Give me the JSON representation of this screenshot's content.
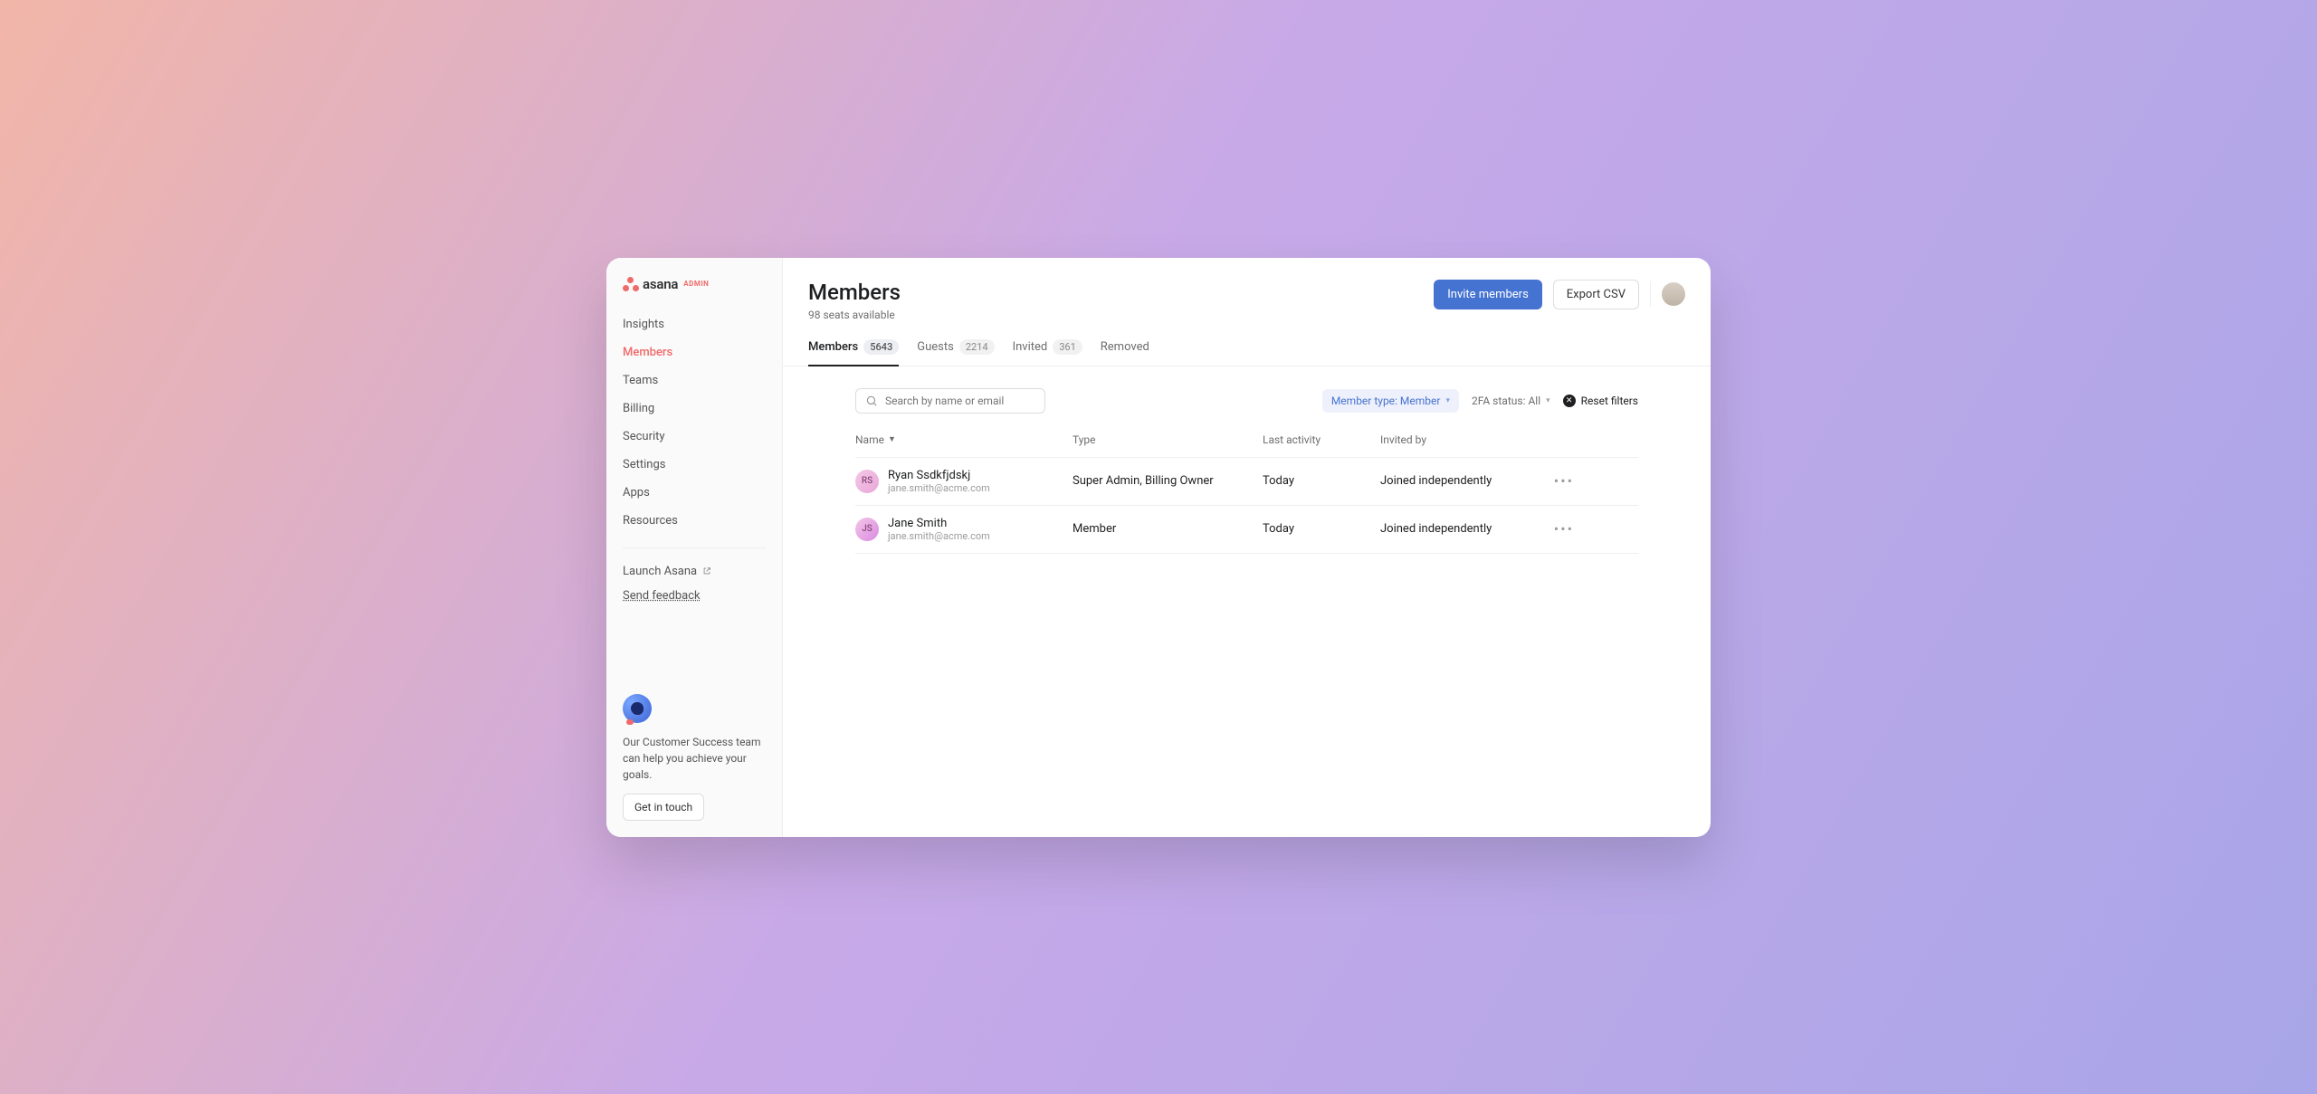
{
  "logo": {
    "brand": "asana",
    "suffix": "ADMIN"
  },
  "sidebar": {
    "items": [
      {
        "label": "Insights"
      },
      {
        "label": "Members"
      },
      {
        "label": "Teams"
      },
      {
        "label": "Billing"
      },
      {
        "label": "Security"
      },
      {
        "label": "Settings"
      },
      {
        "label": "Apps"
      },
      {
        "label": "Resources"
      }
    ],
    "launch_label": "Launch Asana",
    "feedback_label": "Send feedback",
    "promo_text": "Our Customer Success team can help you achieve your goals.",
    "promo_button": "Get in touch"
  },
  "header": {
    "title": "Members",
    "subtitle": "98 seats available",
    "invite_label": "Invite members",
    "export_label": "Export CSV"
  },
  "tabs": [
    {
      "label": "Members",
      "count": "5643"
    },
    {
      "label": "Guests",
      "count": "2214"
    },
    {
      "label": "Invited",
      "count": "361"
    },
    {
      "label": "Removed",
      "count": ""
    }
  ],
  "toolbar": {
    "search_placeholder": "Search by name or email",
    "filter_member_type": "Member type: Member",
    "filter_2fa": "2FA status: All",
    "reset_label": "Reset filters"
  },
  "columns": {
    "name": "Name",
    "type": "Type",
    "last_activity": "Last activity",
    "invited_by": "Invited by"
  },
  "rows": [
    {
      "initials": "RS",
      "name": "Ryan Ssdkfjdskj",
      "email": "jane.smith@acme.com",
      "type": "Super Admin, Billing Owner",
      "last_activity": "Today",
      "invited_by": "Joined independently"
    },
    {
      "initials": "JS",
      "name": "Jane Smith",
      "email": "jane.smith@acme.com",
      "type": "Member",
      "last_activity": "Today",
      "invited_by": "Joined independently"
    }
  ]
}
